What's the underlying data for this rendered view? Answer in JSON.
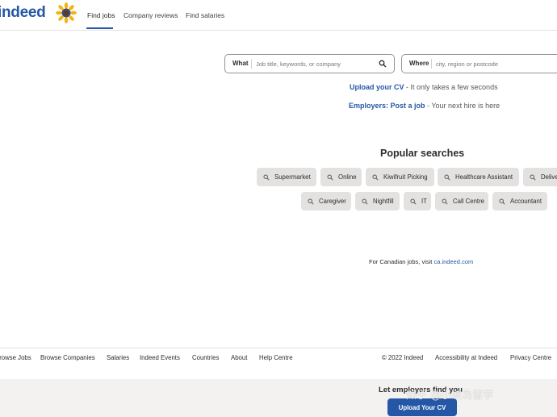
{
  "header": {
    "logo_text": "indeed",
    "logo_icon": "sunflower-icon",
    "nav": [
      "Find jobs",
      "Company reviews",
      "Find salaries"
    ],
    "active_nav": "Find jobs"
  },
  "search": {
    "what_label": "What",
    "what_placeholder": "Job title, keywords, or company",
    "where_label": "Where",
    "where_placeholder": "city, region or postcode"
  },
  "promos": {
    "upload_link": "Upload your CV",
    "upload_rest": " - It only takes a few seconds",
    "employers_link": "Employers: Post a job",
    "employers_rest": " - Your next hire is here"
  },
  "popular": {
    "title": "Popular searches",
    "row1": [
      "Supermarket",
      "Online",
      "Kiwifruit Picking",
      "Healthcare Assistant",
      "Delivery"
    ],
    "row2": [
      "Caregiver",
      "Nightfill",
      "IT",
      "Call Centre",
      "Accountant"
    ]
  },
  "canada": {
    "text": "For Canadian jobs, visit ",
    "link": "ca.indeed.com"
  },
  "footer": {
    "links": [
      "Browse Jobs",
      "Browse Companies",
      "Salaries",
      "Indeed Events",
      "Countries",
      "About",
      "Help Centre"
    ],
    "right_links": [
      "© 2022 Indeed",
      "Accessibility at Indeed",
      "Privacy Centre"
    ]
  },
  "cta": {
    "title": "Let employers find you",
    "button": "Upload Your CV"
  },
  "watermark": "知乎 @小坡岛留学",
  "colors": {
    "brand": "#2557a7",
    "chip": "#e4e2e0",
    "band": "#f3f2f1"
  }
}
